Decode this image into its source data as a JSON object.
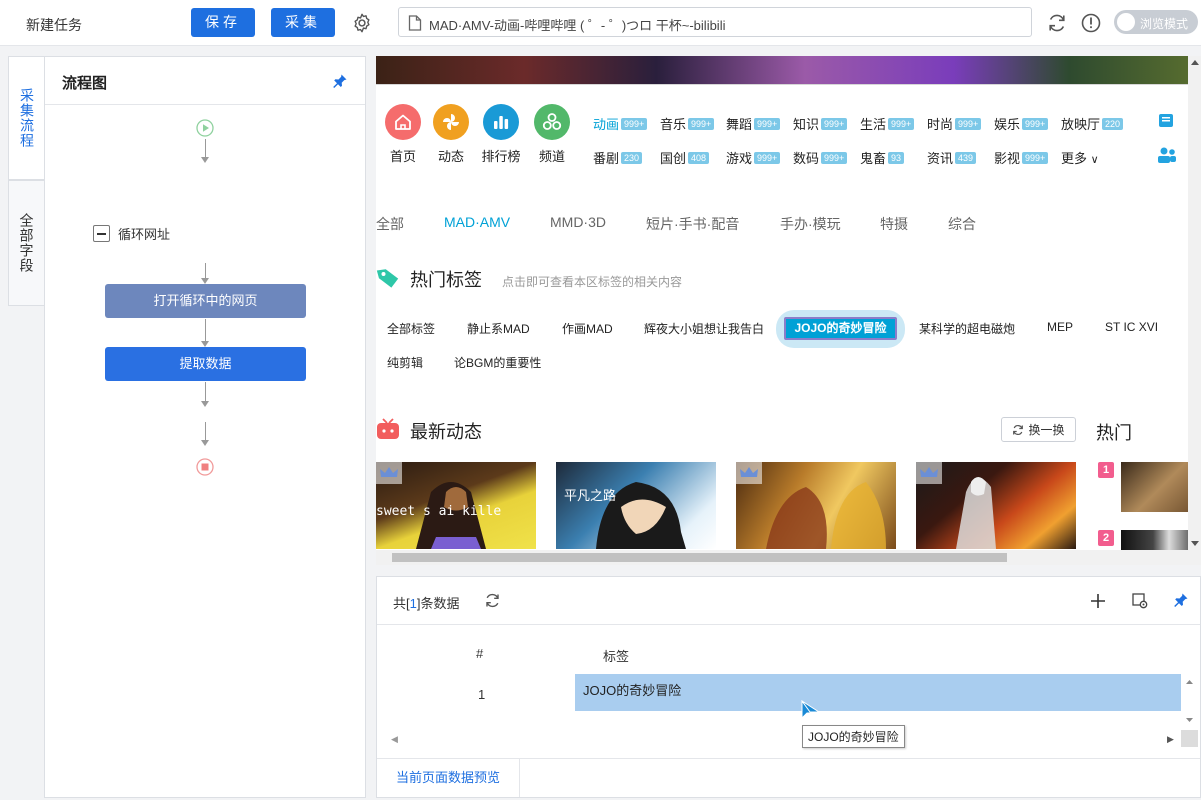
{
  "toolbar": {
    "task_title": "新建任务",
    "save_label": "保存",
    "collect_label": "采集",
    "url": "MAD·AMV-动画-哔哩哔哩 ( ゜- ゜)つロ 干杯~-bilibili",
    "browse_mode_label": "浏览模式"
  },
  "side_tabs": [
    {
      "label": "采集流程",
      "active": true
    },
    {
      "label": "全部字段",
      "active": false
    }
  ],
  "flow": {
    "title": "流程图",
    "loop_label": "循环网址",
    "nodes": [
      "打开循环中的网页",
      "提取数据"
    ]
  },
  "page": {
    "channels": [
      "首页",
      "动态",
      "排行榜",
      "频道"
    ],
    "categories_row1": [
      {
        "name": "动画",
        "count": "999+"
      },
      {
        "name": "音乐",
        "count": "999+"
      },
      {
        "name": "舞蹈",
        "count": "999+"
      },
      {
        "name": "知识",
        "count": "999+"
      },
      {
        "name": "生活",
        "count": "999+"
      },
      {
        "name": "时尚",
        "count": "999+"
      },
      {
        "name": "娱乐",
        "count": "999+"
      },
      {
        "name": "放映厅",
        "count": "220"
      }
    ],
    "categories_row2": [
      {
        "name": "番剧",
        "count": "230"
      },
      {
        "name": "国创",
        "count": "408"
      },
      {
        "name": "游戏",
        "count": "999+"
      },
      {
        "name": "数码",
        "count": "999+"
      },
      {
        "name": "鬼畜",
        "count": "93"
      },
      {
        "name": "资讯",
        "count": "439"
      },
      {
        "name": "影视",
        "count": "999+"
      }
    ],
    "more_label": "更多",
    "subtabs": [
      "全部",
      "MAD·AMV",
      "MMD·3D",
      "短片·手书·配音",
      "手办·模玩",
      "特摄",
      "综合"
    ],
    "hot_tags_title": "热门标签",
    "hot_tags_sub": "点击即可查看本区标签的相关内容",
    "tags_row1": [
      "全部标签",
      "静止系MAD",
      "作画MAD",
      "辉夜大小姐想让我告白",
      "JOJO的奇妙冒险",
      "某科学的超电磁炮",
      "MEP",
      "ST IC XVI"
    ],
    "tags_row2": [
      "纯剪辑",
      "论BGM的重要性"
    ],
    "latest_title": "最新动态",
    "refresh_label": "换一换",
    "hot_label": "热门",
    "ranks": [
      "1",
      "2"
    ],
    "thumb_captions": [
      "sweet s  ai kille",
      "平凡之路"
    ]
  },
  "data": {
    "count_prefix": "共[",
    "count": "1",
    "count_suffix": "]条数据",
    "col_index": "#",
    "col_tag": "标签",
    "rows": [
      {
        "index": "1",
        "tag": "JOJO的奇妙冒险"
      }
    ],
    "tooltip": "JOJO的奇妙冒险",
    "preview_tab": "当前页面数据预览"
  },
  "colors": {
    "primary": "#1e6fe0",
    "bili_blue": "#00a1d6",
    "bili_pink": "#f25d8e",
    "selected_cell": "#a9cdef"
  }
}
